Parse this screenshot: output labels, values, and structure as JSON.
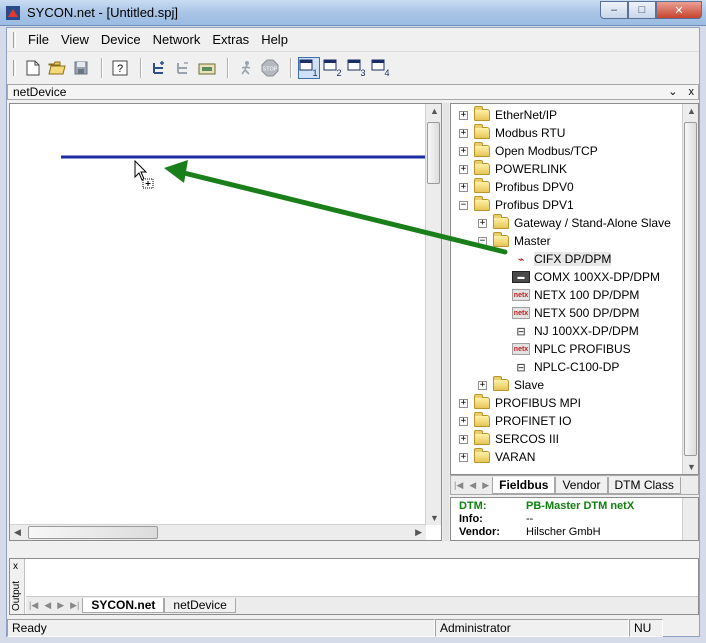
{
  "window": {
    "title": "SYCON.net - [Untitled.spj]"
  },
  "menu": [
    "File",
    "View",
    "Device",
    "Network",
    "Extras",
    "Help"
  ],
  "toolbar": {
    "buttons": [
      "new-icon",
      "open-icon",
      "save-icon",
      "help-icon",
      "add-device-icon",
      "remove-device-icon",
      "network-icon",
      "scan-icon",
      "stop-icon",
      "window1-icon",
      "window2-icon",
      "window3-icon",
      "window4-icon"
    ]
  },
  "panel": {
    "title": "netDevice"
  },
  "tree": {
    "nodes": [
      {
        "label": "EtherNet/IP",
        "level": 0,
        "kind": "folder",
        "expanded": false
      },
      {
        "label": "Modbus RTU",
        "level": 0,
        "kind": "folder",
        "expanded": false
      },
      {
        "label": "Open Modbus/TCP",
        "level": 0,
        "kind": "folder",
        "expanded": false
      },
      {
        "label": "POWERLINK",
        "level": 0,
        "kind": "folder",
        "expanded": false
      },
      {
        "label": "Profibus DPV0",
        "level": 0,
        "kind": "folder",
        "expanded": false
      },
      {
        "label": "Profibus DPV1",
        "level": 0,
        "kind": "folder",
        "expanded": true
      },
      {
        "label": "Gateway / Stand-Alone Slave",
        "level": 1,
        "kind": "folder",
        "expanded": false
      },
      {
        "label": "Master",
        "level": 1,
        "kind": "folder",
        "expanded": true
      },
      {
        "label": "CIFX DP/DPM",
        "level": 2,
        "kind": "cifx",
        "selected": true
      },
      {
        "label": "COMX 100XX-DP/DPM",
        "level": 2,
        "kind": "card"
      },
      {
        "label": "NETX 100 DP/DPM",
        "level": 2,
        "kind": "netx"
      },
      {
        "label": "NETX 500 DP/DPM",
        "level": 2,
        "kind": "netx"
      },
      {
        "label": "NJ 100XX-DP/DPM",
        "level": 2,
        "kind": "plc"
      },
      {
        "label": "NPLC PROFIBUS",
        "level": 2,
        "kind": "netx"
      },
      {
        "label": "NPLC-C100-DP",
        "level": 2,
        "kind": "plc"
      },
      {
        "label": "Slave",
        "level": 1,
        "kind": "folder",
        "expanded": false
      },
      {
        "label": "PROFIBUS MPI",
        "level": 0,
        "kind": "folder",
        "expanded": false
      },
      {
        "label": "PROFINET IO",
        "level": 0,
        "kind": "folder",
        "expanded": false
      },
      {
        "label": "SERCOS III",
        "level": 0,
        "kind": "folder",
        "expanded": false
      },
      {
        "label": "VARAN",
        "level": 0,
        "kind": "folder",
        "expanded": false
      }
    ]
  },
  "catalog_tabs": [
    "Fieldbus",
    "Vendor",
    "DTM Class"
  ],
  "info": {
    "rows": [
      {
        "key": "DTM:",
        "value": "PB-Master DTM netX"
      },
      {
        "key": "Info:",
        "value": "--"
      },
      {
        "key": "Vendor:",
        "value": "Hilscher GmbH"
      }
    ]
  },
  "output": {
    "label": "Output",
    "close": "x",
    "tabs": [
      "SYCON.net",
      "netDevice"
    ]
  },
  "status": {
    "text": "Ready",
    "user": "Administrator",
    "num": "NU"
  },
  "icons": {
    "winbtn_min": "–",
    "winbtn_max": "□",
    "winbtn_close": "✕",
    "panel_pin": "⌄",
    "panel_close": "x"
  }
}
